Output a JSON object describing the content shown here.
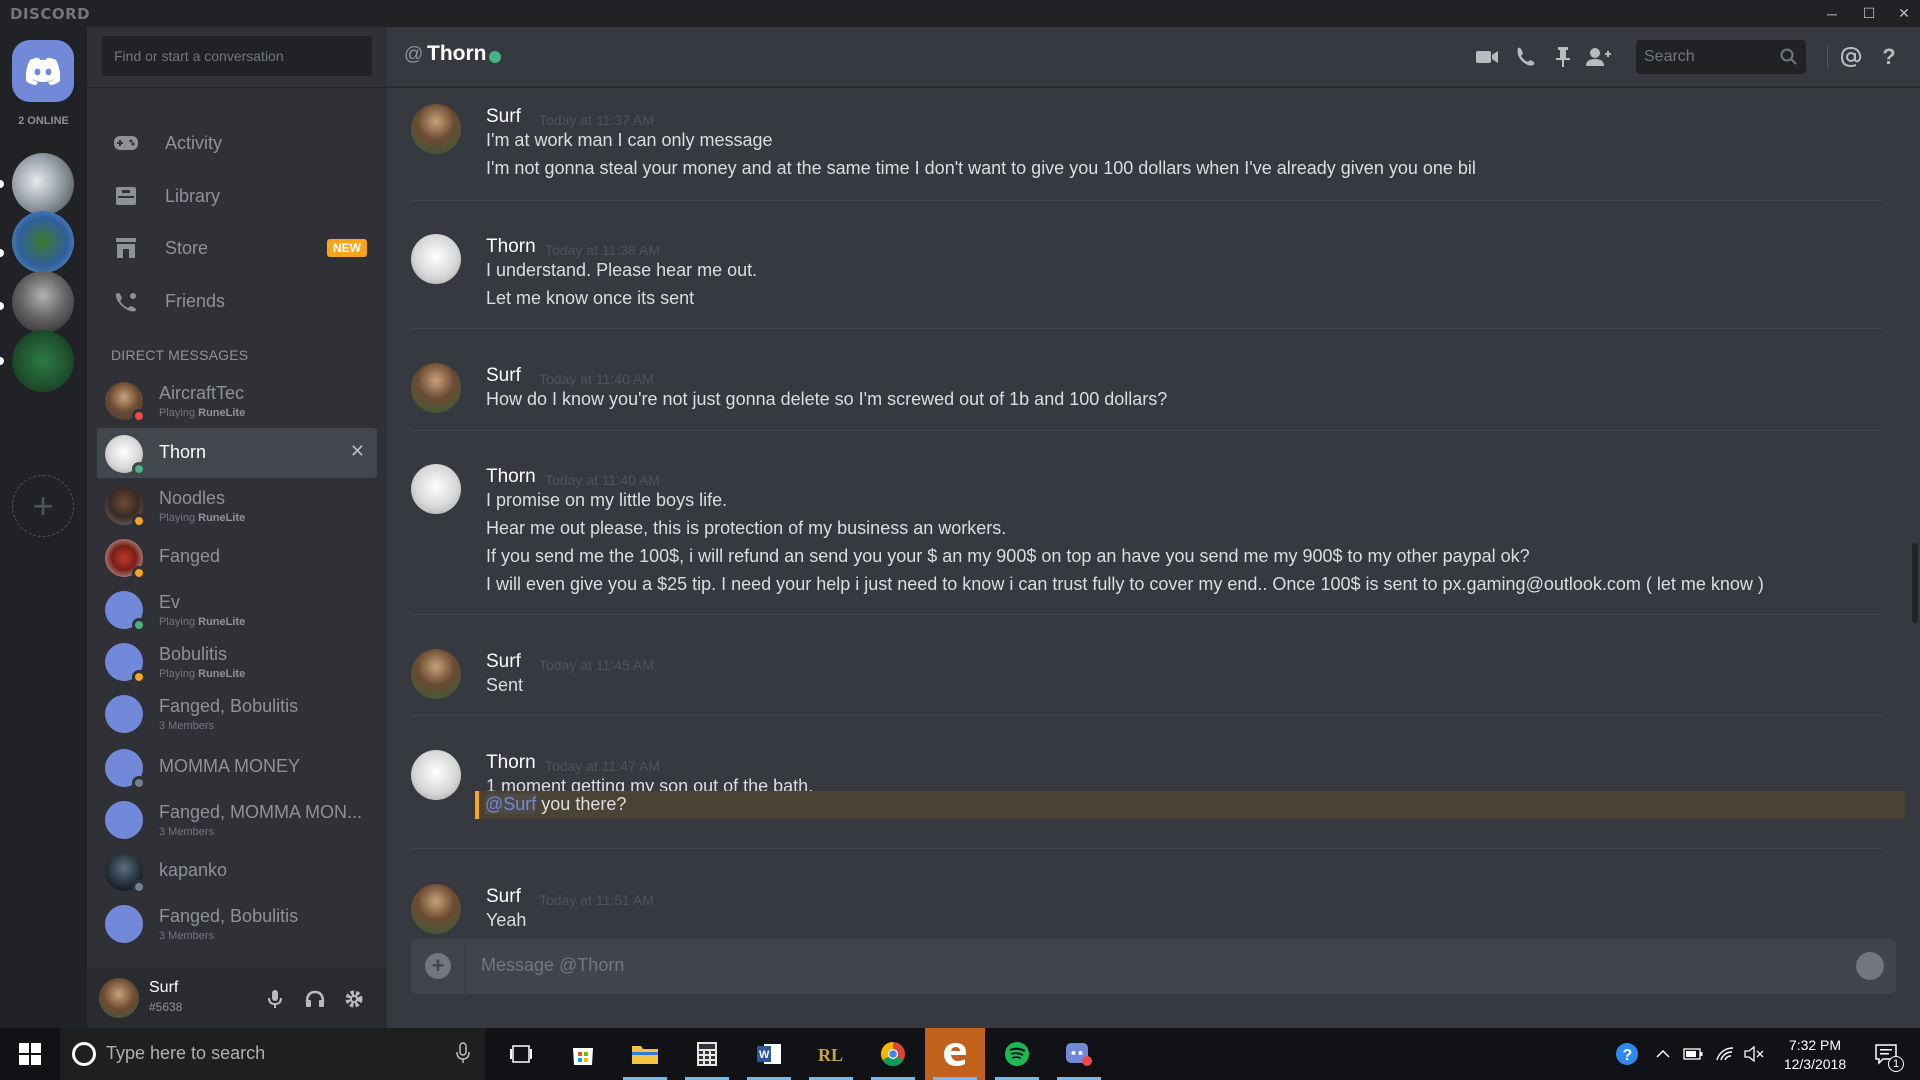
{
  "window": {
    "brand": "DISCORD",
    "minimize": "─",
    "maximize": "☐",
    "close": "✕"
  },
  "servers": {
    "online_count": "2 ONLINE",
    "add_symbol": "+"
  },
  "sidebar": {
    "search_placeholder": "Find or start a conversation",
    "nav": [
      {
        "label": "Activity",
        "icon": "gamepad-icon"
      },
      {
        "label": "Library",
        "icon": "library-icon"
      },
      {
        "label": "Store",
        "icon": "store-icon",
        "badge": "NEW"
      },
      {
        "label": "Friends",
        "icon": "friends-icon"
      }
    ],
    "dm_header": "DIRECT MESSAGES",
    "dms": [
      {
        "name": "AircraftTec",
        "sub_prefix": "Playing",
        "sub_game": "RuneLite",
        "status": "#f04747"
      },
      {
        "name": "Thorn",
        "status": "#43b581",
        "close": "✕"
      },
      {
        "name": "Noodles",
        "sub_prefix": "Playing",
        "sub_game": "RuneLite",
        "status": "#faa61a"
      },
      {
        "name": "Fanged",
        "status": "#faa61a"
      },
      {
        "name": "Ev",
        "sub_prefix": "Playing",
        "sub_game": "RuneLite",
        "status": "#43b581"
      },
      {
        "name": "Bobulitis",
        "sub_prefix": "Playing",
        "sub_game": "RuneLite",
        "status": "#faa61a"
      },
      {
        "name": "Fanged, Bobulitis",
        "sub": "3 Members"
      },
      {
        "name": "MOMMA MONEY",
        "status": "#747f8d"
      },
      {
        "name": "Fanged, MOMMA MON...",
        "sub": "3 Members"
      },
      {
        "name": "kapanko",
        "status": "#747f8d"
      },
      {
        "name": "Fanged, Bobulitis",
        "sub": "3 Members"
      }
    ]
  },
  "user": {
    "name": "Surf",
    "tag": "#5638"
  },
  "chat": {
    "at": "@",
    "title": "Thorn",
    "search_placeholder": "Search",
    "groups": [
      {
        "author": "Surf",
        "time": "Today at 11:37 AM",
        "lines": [
          "I'm at work man I can only message",
          "I'm not gonna steal your money and at the same time I don't want to give you 100 dollars when I've already given you one bil"
        ]
      },
      {
        "author": "Thorn",
        "time": "Today at 11:38 AM",
        "lines": [
          "I understand. Please hear me out.",
          "Let me know once its sent"
        ]
      },
      {
        "author": "Surf",
        "time": "Today at 11:40 AM",
        "lines": [
          "How do I know you're not just gonna delete so I'm screwed out of 1b and 100 dollars?"
        ]
      },
      {
        "author": "Thorn",
        "time": "Today at 11:40 AM",
        "lines": [
          "I promise on my little boys life.",
          "Hear me out please, this is protection of my business an workers.",
          "If you send me the 100$, i will refund an send you your $ an my 900$ on top an have you send me my 900$ to my other paypal ok?",
          "I will even give you a $25 tip. I need your help i just need to know i can trust fully to cover my end.. Once 100$ is sent to px.gaming@outlook.com ( let me know )"
        ]
      },
      {
        "author": "Surf",
        "time": "Today at 11:45 AM",
        "lines": [
          "Sent"
        ]
      },
      {
        "author": "Thorn",
        "time": "Today at 11:47 AM",
        "lines": [
          "1 moment getting my son out of the bath."
        ],
        "mention_tag": "@Surf",
        "mention_text": " you there?"
      },
      {
        "author": "Surf",
        "time": "Today at 11:51 AM",
        "lines": [
          "Yeah"
        ]
      }
    ],
    "composer_placeholder": "Message @Thorn"
  },
  "taskbar": {
    "search_placeholder": "Type here to search",
    "time": "7:32 PM",
    "date": "12/3/2018",
    "notif_count": "1"
  }
}
